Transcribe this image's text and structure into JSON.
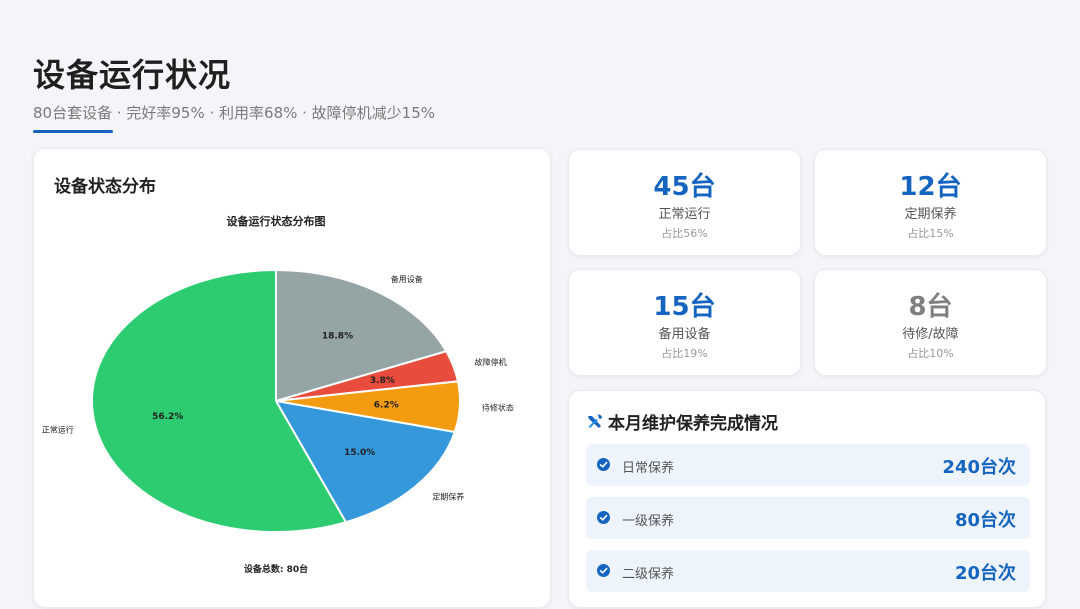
{
  "page": {
    "title": "设备运行状况",
    "subtitle": "80台套设备 · 完好率95% · 利用率68% · 故障停机减少15%"
  },
  "chart_card": {
    "title": "设备状态分布"
  },
  "chart_data": {
    "type": "pie",
    "title": "设备运行状态分布图",
    "footer": "设备总数: 80台",
    "slices": [
      {
        "label": "备用设备",
        "value": 18.8,
        "pct_label": "18.8%",
        "color": "#95a5a6"
      },
      {
        "label": "故障停机",
        "value": 3.8,
        "pct_label": "3.8%",
        "color": "#e74c3c"
      },
      {
        "label": "待修状态",
        "value": 6.2,
        "pct_label": "6.2%",
        "color": "#f39c12"
      },
      {
        "label": "定期保养",
        "value": 15.0,
        "pct_label": "15.0%",
        "color": "#3498db"
      },
      {
        "label": "正常运行",
        "value": 56.2,
        "pct_label": "56.2%",
        "color": "#2ecc71"
      }
    ]
  },
  "stats": [
    {
      "value": "45台",
      "label": "正常运行",
      "ratio": "占比56%",
      "color": "#1565c0"
    },
    {
      "value": "12台",
      "label": "定期保养",
      "ratio": "占比15%",
      "color": "#1565c0"
    },
    {
      "value": "15台",
      "label": "备用设备",
      "ratio": "占比19%",
      "color": "#1565c0"
    },
    {
      "value": "8台",
      "label": "待修/故障",
      "ratio": "占比10%",
      "color": "#7f7f7f"
    }
  ],
  "maintenance": {
    "title": "本月维护保养完成情况",
    "icon": "tools-icon",
    "items": [
      {
        "label": "日常保养",
        "count": "240台次"
      },
      {
        "label": "一级保养",
        "count": "80台次"
      },
      {
        "label": "二级保养",
        "count": "20台次"
      }
    ]
  }
}
